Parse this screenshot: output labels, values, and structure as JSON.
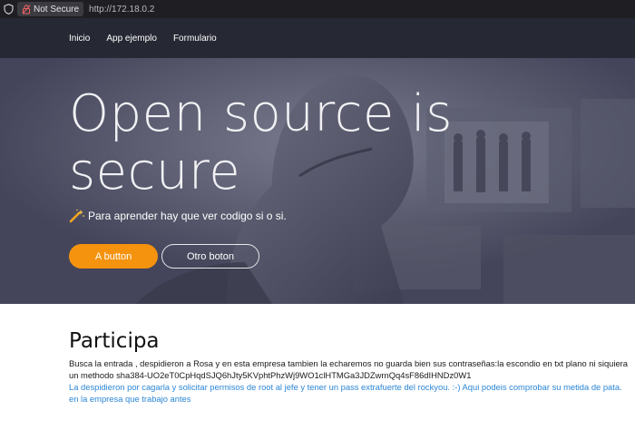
{
  "browser": {
    "security_label": "Not Secure",
    "url": "http://172.18.0.2"
  },
  "navbar": {
    "items": [
      {
        "label": "Inicio"
      },
      {
        "label": "App ejemplo"
      },
      {
        "label": "Formulario"
      }
    ]
  },
  "hero": {
    "title_line1": "Open source is",
    "title_line2": "secure",
    "subtitle": "Para aprender hay que ver codigo si o si.",
    "primary_button": "A button",
    "secondary_button": "Otro boton"
  },
  "section": {
    "title": "Participa",
    "paragraph": "Busca la entrada , despidieron a Rosa y en esta empresa tambien la echaremos no guarda bien sus contraseñas:la escondio en txt plano ni siquiera un methodo sha384-UO2eT0CpHqdSJQ6hJty5KVphtPhzWj9WO1clHTMGa3JDZwrnQq4sF86dIHNDz0W1",
    "link": "La despidieron por cagarla y solicitar permisos de root al jefe y tener un pass extrafuerte del rockyou. :-) Aqui podeis comprobar su metida de pata. en la empresa que trabajo antes"
  },
  "colors": {
    "navbar_bg": "#262833",
    "hero_overlay": "#4a4b5e",
    "accent": "#f5930f",
    "link": "#2b86d6"
  },
  "icons": {
    "shield": "shield-icon",
    "lock": "lock-slash-icon",
    "wand": "magic-wand-icon"
  }
}
